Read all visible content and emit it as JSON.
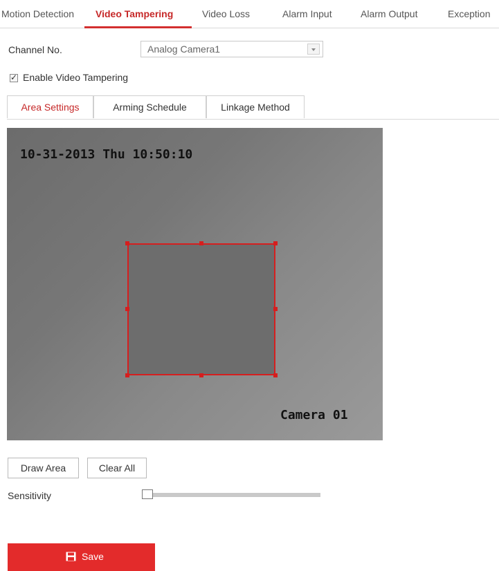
{
  "top_tabs": [
    {
      "label": "Motion Detection"
    },
    {
      "label": "Video Tampering"
    },
    {
      "label": "Video Loss"
    },
    {
      "label": "Alarm Input"
    },
    {
      "label": "Alarm Output"
    },
    {
      "label": "Exception"
    }
  ],
  "channel": {
    "label": "Channel No.",
    "selected": "Analog Camera1"
  },
  "enable": {
    "label": "Enable Video Tampering",
    "checked": true
  },
  "sub_tabs": [
    {
      "label": "Area Settings"
    },
    {
      "label": "Arming Schedule"
    },
    {
      "label": "Linkage Method"
    }
  ],
  "camera": {
    "timestamp": "10-31-2013 Thu 10:50:10",
    "name": "Camera 01"
  },
  "buttons": {
    "draw_area": "Draw Area",
    "clear_all": "Clear All"
  },
  "sensitivity": {
    "label": "Sensitivity",
    "value_percent": 0
  },
  "save": {
    "label": "Save",
    "icon": "save-icon"
  },
  "colors": {
    "accent": "#d32f2f",
    "save_button": "#e32b2b",
    "area_border": "#d61e1e"
  }
}
